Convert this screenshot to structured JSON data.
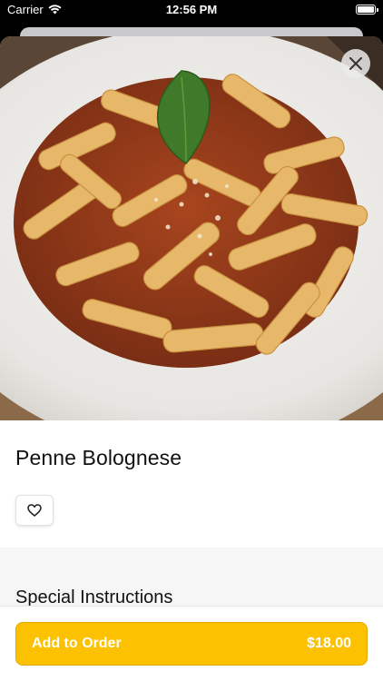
{
  "status_bar": {
    "carrier": "Carrier",
    "time": "12:56 PM",
    "icons": [
      "wifi-icon",
      "battery-icon"
    ]
  },
  "item": {
    "name": "Penne Bolognese",
    "image_description_icon": "penne-bolognese-photo"
  },
  "actions": {
    "close_icon": "close-icon",
    "favorite_icon": "heart-icon"
  },
  "special_instructions": {
    "title": "Special Instructions"
  },
  "order": {
    "button_label": "Add to Order",
    "price": "$18.00"
  },
  "colors": {
    "accent": "#fcc201",
    "accent_border": "#e0a800",
    "text": "#111111",
    "band": "#f6f6f6"
  }
}
